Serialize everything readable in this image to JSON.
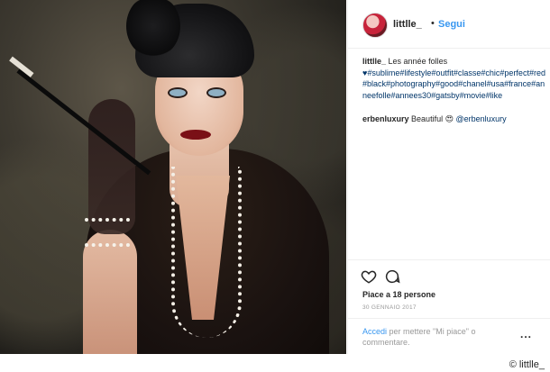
{
  "header": {
    "username": "littlle_",
    "separator": "•",
    "follow_label": "Segui"
  },
  "caption": {
    "username": "littlle_",
    "text": "Les année folles",
    "tags": "♥#sublime#lifestyle#outfit#classe#chic#perfect#red#black#photography#good#chanel#usa#france#anneefolle#annees30#gatsby#movie#like"
  },
  "comment": {
    "username": "erbenluxury",
    "text": "Beautiful 😍",
    "mention": "@erbenluxury"
  },
  "actions": {
    "likes": "Piace a 18 persone",
    "date": "30 gennaio 2017"
  },
  "login": {
    "link_label": "Accedi",
    "text": "per mettere \"Mi piace\" o commentare."
  },
  "more_label": "...",
  "credit": "© littlle_"
}
